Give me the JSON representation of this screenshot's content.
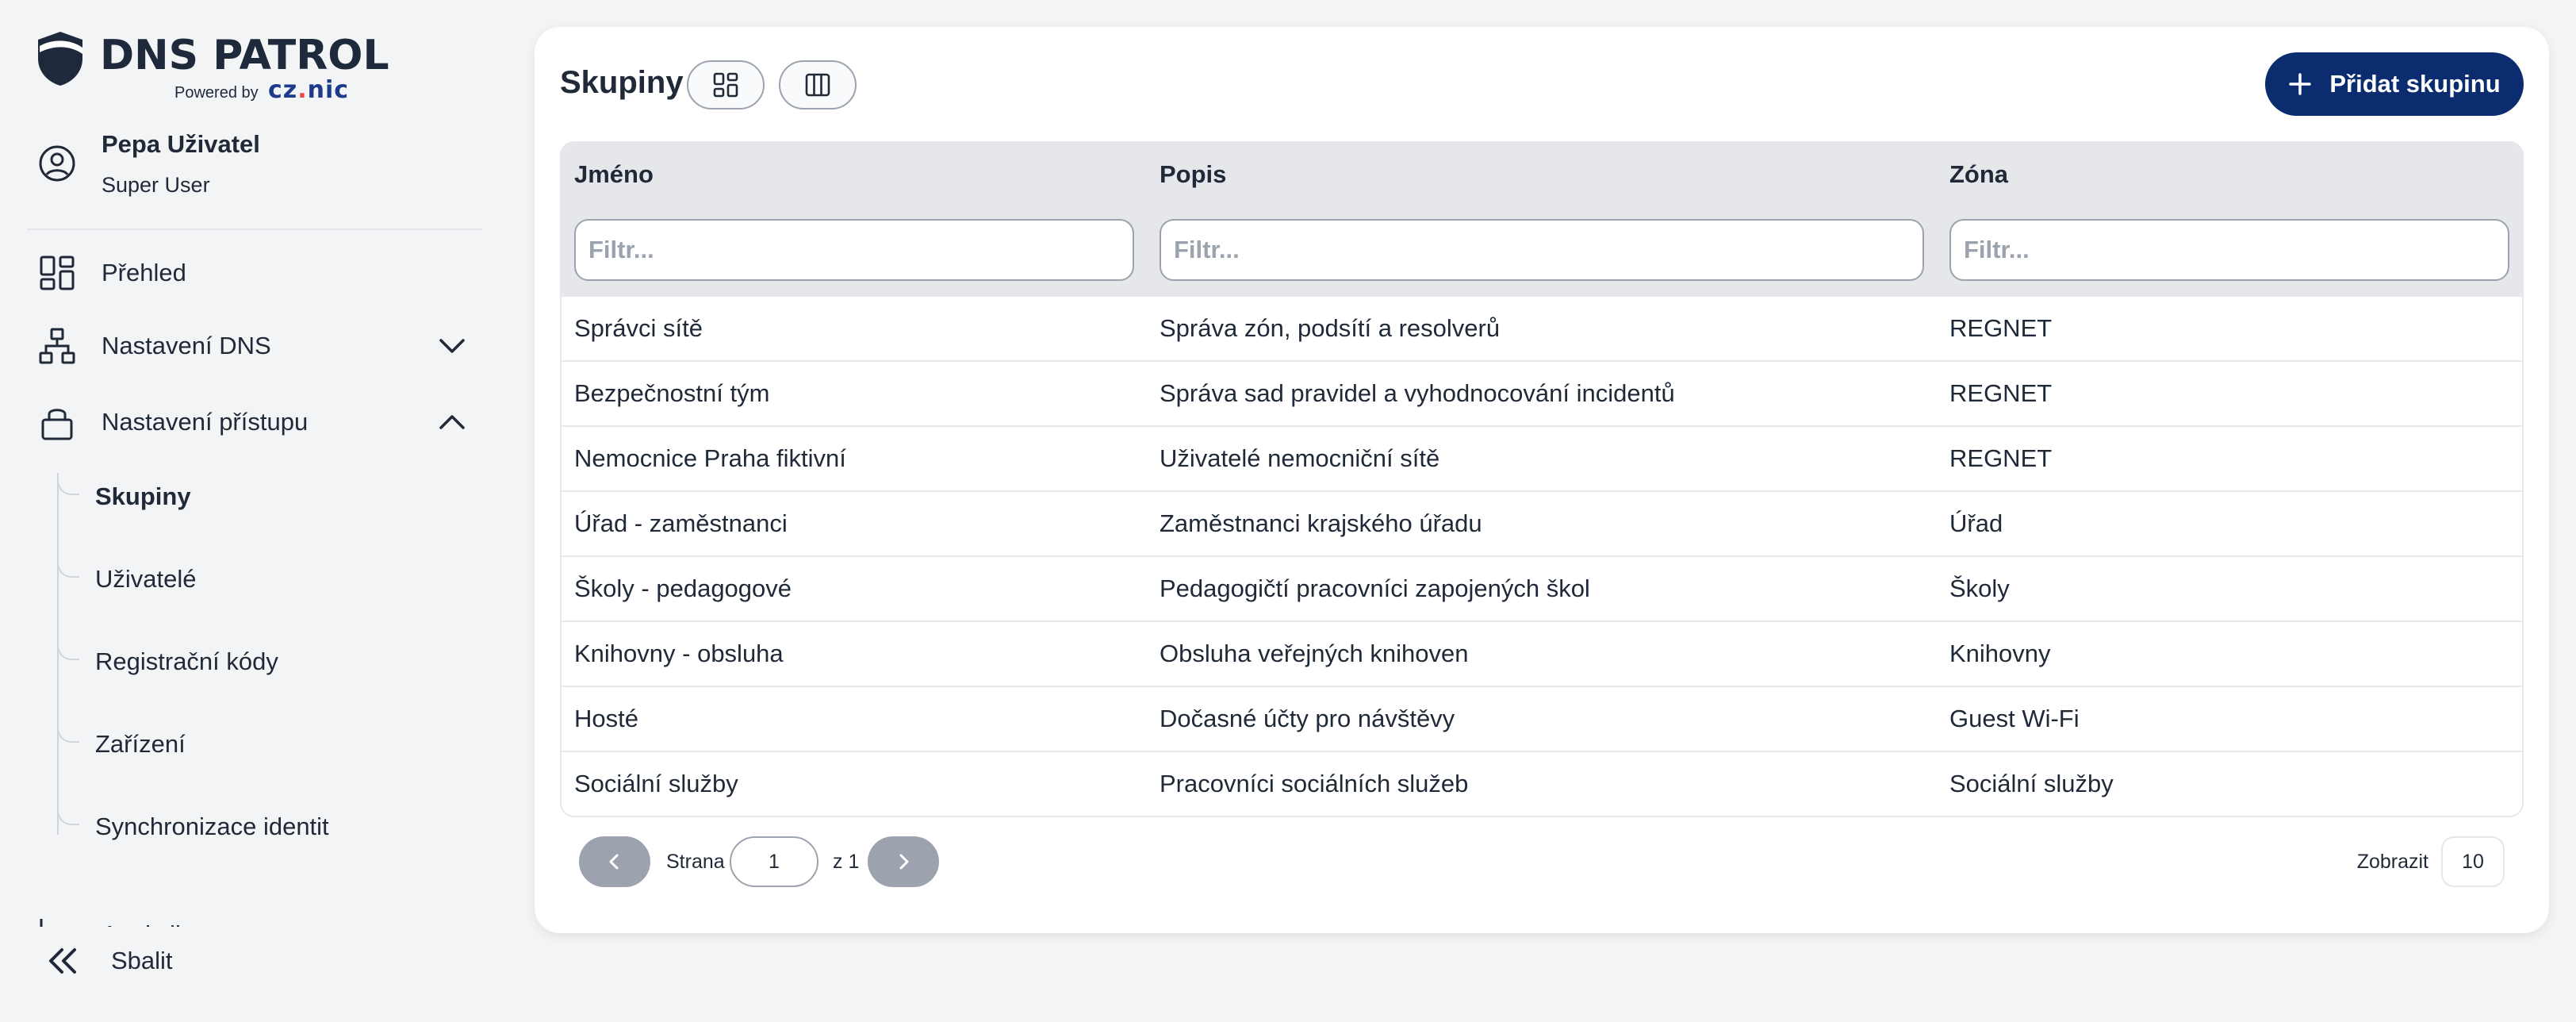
{
  "brand": {
    "name": "DNS PATROL",
    "powered_by": "Powered by",
    "partner_main": "cz",
    "partner_dot": ".",
    "partner_end": "nic"
  },
  "user": {
    "name": "Pepa Uživatel",
    "role": "Super User"
  },
  "nav": {
    "overview": "Přehled",
    "dns_settings": "Nastavení DNS",
    "access_settings": "Nastavení přístupu",
    "sub_items": [
      "Skupiny",
      "Uživatelé",
      "Registrační kódy",
      "Zařízení",
      "Synchronizace identit"
    ],
    "truncated_item": "Analytika",
    "collapse": "Sbalit"
  },
  "page": {
    "title": "Skupiny",
    "add_button": "Přidat skupinu"
  },
  "table": {
    "columns": [
      "Jméno",
      "Popis",
      "Zóna"
    ],
    "filter_placeholder": "Filtr...",
    "rows": [
      [
        "Správci sítě",
        "Správa zón, podsítí a resolverů",
        "REGNET"
      ],
      [
        "Bezpečnostní tým",
        "Správa sad pravidel a vyhodnocování incidentů",
        "REGNET"
      ],
      [
        "Nemocnice Praha fiktivní",
        "Uživatelé nemocniční sítě",
        "REGNET"
      ],
      [
        "Úřad - zaměstnanci",
        "Zaměstnanci krajského úřadu",
        "Úřad"
      ],
      [
        "Školy - pedagogové",
        "Pedagogičtí pracovníci zapojených škol",
        "Školy"
      ],
      [
        "Knihovny - obsluha",
        "Obsluha veřejných knihoven",
        "Knihovny"
      ],
      [
        "Hosté",
        "Dočasné účty pro návštěvy",
        "Guest Wi-Fi"
      ],
      [
        "Sociální služby",
        "Pracovníci sociálních služeb",
        "Sociální služby"
      ]
    ]
  },
  "pagination": {
    "page_label": "Strana",
    "current_page": "1",
    "of_label": "z 1",
    "show_label": "Zobrazit",
    "page_size": "10"
  },
  "colors": {
    "primary": "#0b2c6e",
    "background": "#f3f4f6",
    "header_bg": "#e5e7eb",
    "disabled": "#9ca3af"
  }
}
